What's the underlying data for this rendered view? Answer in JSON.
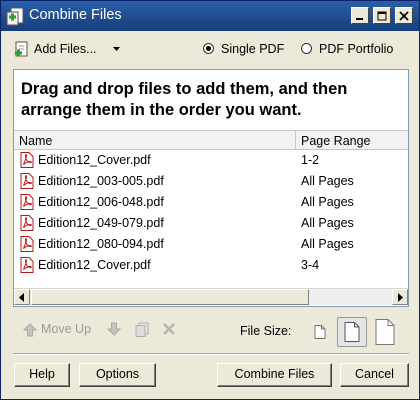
{
  "window": {
    "title": "Combine Files"
  },
  "toolbar": {
    "add_files_label": "Add Files...",
    "radio_single_label": "Single PDF",
    "radio_portfolio_label": "PDF Portfolio",
    "selected_option": "Single PDF"
  },
  "panel": {
    "instructions": "Drag and drop files to add them, and then arrange them in the order you want.",
    "columns": {
      "name": "Name",
      "page_range": "Page Range"
    },
    "files": [
      {
        "name": "Edition12_Cover.pdf",
        "page_range": "1-2"
      },
      {
        "name": "Edition12_003-005.pdf",
        "page_range": "All Pages"
      },
      {
        "name": "Edition12_006-048.pdf",
        "page_range": "All Pages"
      },
      {
        "name": "Edition12_049-079.pdf",
        "page_range": "All Pages"
      },
      {
        "name": "Edition12_080-094.pdf",
        "page_range": "All Pages"
      },
      {
        "name": "Edition12_Cover.pdf",
        "page_range": "3-4"
      }
    ]
  },
  "actions": {
    "move_up_label": "Move Up",
    "file_size_label": "File Size:",
    "file_size_selected": "medium"
  },
  "buttons": {
    "help": "Help",
    "options": "Options",
    "combine": "Combine Files",
    "cancel": "Cancel"
  },
  "colors": {
    "titlebar": "#1e4f95",
    "pdf_icon": "#cc1a1a",
    "window_bg": "#ece9d8",
    "disabled_text": "#9a9a9a"
  }
}
